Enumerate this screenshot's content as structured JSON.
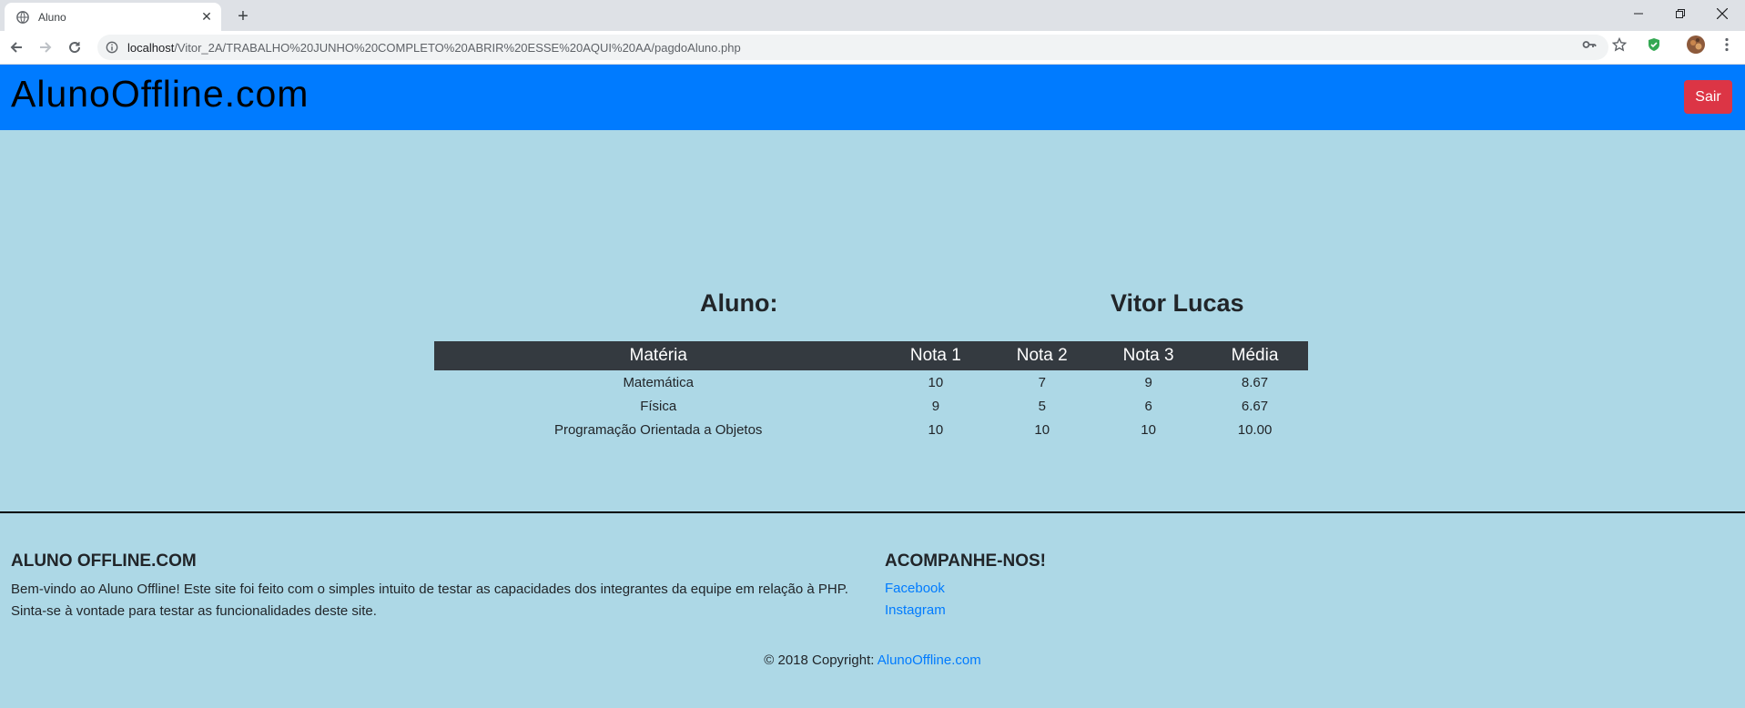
{
  "browser": {
    "tab_title": "Aluno",
    "url_host": "localhost",
    "url_path": "/Vitor_2A/TRABALHO%20JUNHO%20COMPLETO%20ABRIR%20ESSE%20AQUI%20AA/pagdoAluno.php",
    "icons": [
      "globe-icon",
      "close-icon",
      "plus-icon",
      "back-icon",
      "forward-icon",
      "reload-icon",
      "info-icon",
      "key-icon",
      "star-icon",
      "shield-icon",
      "avatar",
      "menu-icon",
      "minimize-icon",
      "restore-icon",
      "window-close-icon"
    ]
  },
  "navbar": {
    "brand": "AlunoOffline.com",
    "logout_label": "Sair",
    "background": "#007bff",
    "logout_color": "#dc3545"
  },
  "student": {
    "label": "Aluno:",
    "name": "Vitor Lucas"
  },
  "grades": {
    "headers": [
      "Matéria",
      "Nota 1",
      "Nota 2",
      "Nota 3",
      "Média"
    ],
    "rows": [
      [
        "Matemática",
        "10",
        "7",
        "9",
        "8.67"
      ],
      [
        "Física",
        "9",
        "5",
        "6",
        "6.67"
      ],
      [
        "Programação Orientada a Objetos",
        "10",
        "10",
        "10",
        "10.00"
      ]
    ],
    "header_background": "#343a40"
  },
  "footer": {
    "about_title": "ALUNO OFFLINE.COM",
    "about_text": "Bem-vindo ao Aluno Offline! Este site foi feito com o simples intuito de testar as capacidades dos integrantes da equipe em relação à PHP. Sinta-se à vontade para testar as funcionalidades deste site.",
    "follow_title": "ACOMPANHE-NOS!",
    "links": [
      "Facebook",
      "Instagram"
    ],
    "copyright_prefix": "© 2018 Copyright: ",
    "copyright_link": "AlunoOffline.com",
    "link_color": "#007bff"
  },
  "page_background": "#add8e6"
}
